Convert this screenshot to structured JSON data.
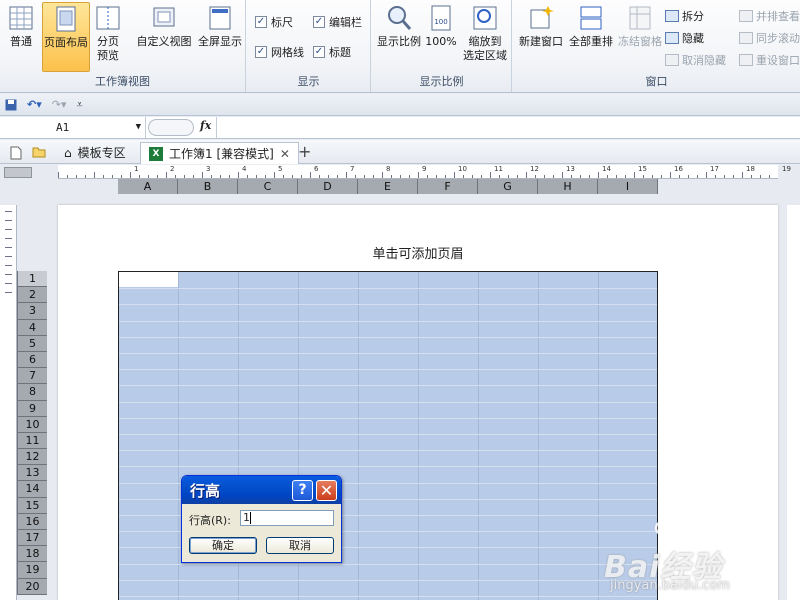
{
  "ribbon": {
    "workbook_views": {
      "label": "工作簿视图",
      "normal": "普通",
      "page_layout": "页面布局",
      "page_break_1": "分页",
      "page_break_2": "预览",
      "custom_view": "自定义视图",
      "full_screen": "全屏显示"
    },
    "show": {
      "label": "显示",
      "ruler": "标尺",
      "formula_bar": "编辑栏",
      "gridlines": "网格线",
      "headings": "标题"
    },
    "zoom": {
      "label": "显示比例",
      "zoom": "显示比例",
      "hundred": "100%",
      "zoom_selection_1": "缩放到",
      "zoom_selection_2": "选定区域"
    },
    "window": {
      "label": "窗口",
      "new_window": "新建窗口",
      "arrange_all": "全部重排",
      "freeze_panes": "冻结窗格",
      "split": "拆分",
      "hide": "隐藏",
      "unhide": "取消隐藏",
      "side_by_side": "并排查看",
      "sync_scroll": "同步滚动",
      "reset_pos": "重设窗口"
    }
  },
  "formula_bar": {
    "name_box": "A1",
    "fx": "fx"
  },
  "tabs": [
    {
      "label": "模板专区"
    },
    {
      "label": "工作簿1 [兼容模式]"
    }
  ],
  "columns": [
    "A",
    "B",
    "C",
    "D",
    "E",
    "F",
    "G",
    "H",
    "I"
  ],
  "rows": [
    "1",
    "2",
    "3",
    "4",
    "5",
    "6",
    "7",
    "8",
    "9",
    "10",
    "11",
    "12",
    "13",
    "14",
    "15",
    "16",
    "17",
    "18",
    "19",
    "20"
  ],
  "ruler_numbers": [
    "1",
    "2",
    "3",
    "4",
    "5",
    "6",
    "7",
    "8",
    "9",
    "10",
    "11",
    "12",
    "13",
    "14",
    "15",
    "16",
    "17",
    "18",
    "19"
  ],
  "page": {
    "header_placeholder": "单击可添加页眉"
  },
  "dialog": {
    "title": "行高",
    "help": "?",
    "close": "✕",
    "label": "行高(R):",
    "value": "1",
    "ok": "确定",
    "cancel": "取消"
  },
  "watermark": {
    "brand": "Bai经验",
    "url": "jingyan.baidu.com"
  },
  "colors": {
    "selection": "#b8cbe8",
    "dialog_title": "#0553cf",
    "active_button": "#fbc14b"
  }
}
